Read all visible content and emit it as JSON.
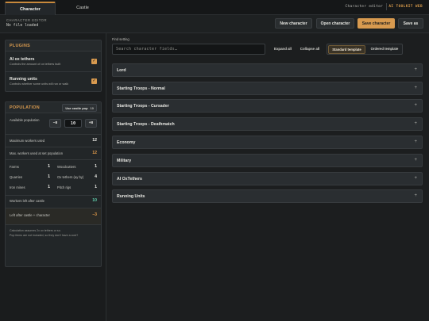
{
  "tabs": [
    {
      "label": "Character"
    },
    {
      "label": "Castle"
    }
  ],
  "topright": {
    "left_label": "Character editor",
    "brand": "AI TOOLKIT WEB"
  },
  "filebar": {
    "label": "CHARACTER EDITOR",
    "status": "No file loaded",
    "buttons": {
      "new": "New character",
      "open": "Open character",
      "save_char": "Save character",
      "save_as": "Save as"
    }
  },
  "plugins": {
    "title": "PLUGINS",
    "items": [
      {
        "name": "AI ox tethers",
        "desc": "Controls the amount of ox tethers built",
        "checked": true
      },
      {
        "name": "Running units",
        "desc": "Controls whether some units will run or walk",
        "checked": true
      }
    ]
  },
  "population": {
    "title": "POPULATION",
    "use_castle_pop": "Use castle pop",
    "castle_pop_count": "10",
    "available_label": "Available population",
    "minus": "−8",
    "value": "10",
    "plus": "+8",
    "max_workers_label": "Maximum workers used",
    "max_workers_value": "12",
    "max_at_set_label": "Max. workers used at set population",
    "max_at_set_value": "12",
    "grid": [
      {
        "label": "Farms",
        "value": "1"
      },
      {
        "label": "Woodcutters",
        "value": "1"
      },
      {
        "label": "Quarries",
        "value": "1"
      },
      {
        "label": "Ox tethers (ay by)",
        "value": "4"
      },
      {
        "label": "Iron mines",
        "value": "1"
      },
      {
        "label": "Pitch rigs",
        "value": "1"
      }
    ],
    "workers_left_label": "Workers left after castle",
    "workers_left_value": "10",
    "left_after_label": "Left after castle + character",
    "left_after_value": "−3",
    "footnote_1": "Calculation assumes 2x ox tethers or so.",
    "footnote_2": "Pop items are not included, so they don't have a cost?"
  },
  "main": {
    "find_label": "Find setting",
    "search_placeholder": "Search character fields…",
    "expand_all": "Expand all",
    "collapse_all": "Collapse all",
    "tpl_standard": "Standard template",
    "tpl_ordered": "Ordered template",
    "sections": [
      "Lord",
      "Starting Troops - Normal",
      "Starting Troops - Cursader",
      "Starting Troops - Deathmatch",
      "Economy",
      "Military",
      "AI OxTethers",
      "Running Units"
    ],
    "plus_glyph": "+"
  },
  "colors": {
    "accent": "#d89a4f",
    "teal": "#5fc9a8",
    "orange": "#e09a4a"
  }
}
